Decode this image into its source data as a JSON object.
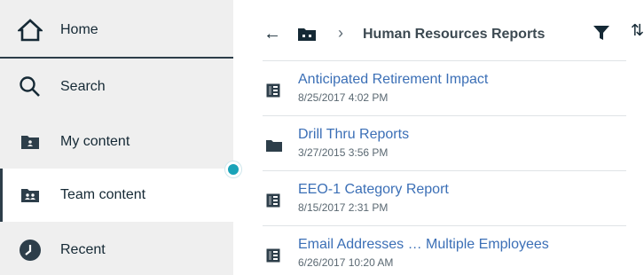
{
  "sidebar": {
    "items": [
      {
        "label": "Home",
        "icon": "home-icon"
      },
      {
        "label": "Search",
        "icon": "search-icon"
      },
      {
        "label": "My content",
        "icon": "my-content-icon"
      },
      {
        "label": "Team content",
        "icon": "team-content-icon",
        "selected": true
      },
      {
        "label": "Recent",
        "icon": "recent-icon"
      }
    ]
  },
  "header": {
    "title": "Human Resources Reports"
  },
  "content": {
    "items": [
      {
        "name": "Anticipated Retirement Impact",
        "date": "8/25/2017 4:02 PM",
        "type": "report"
      },
      {
        "name": "Drill Thru Reports",
        "date": "3/27/2015 3:56 PM",
        "type": "folder"
      },
      {
        "name": "EEO-1 Category Report",
        "date": "8/15/2017 2:31 PM",
        "type": "report"
      },
      {
        "name": "Email Addresses … Multiple Employees",
        "date": "6/26/2017 10:20 AM",
        "type": "report"
      }
    ]
  },
  "colors": {
    "accent": "#19a3b8",
    "link": "#3b6fb6",
    "sidebar_bg": "#efefef",
    "icon_dark": "#2d3e4a"
  }
}
